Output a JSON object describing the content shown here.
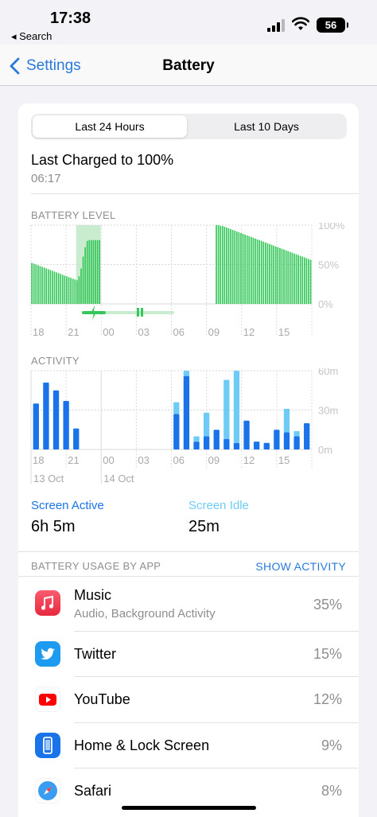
{
  "status_bar": {
    "time": "17:38",
    "back_app": "◂ Search",
    "battery_level": "56"
  },
  "nav": {
    "back_label": "Settings",
    "title": "Battery"
  },
  "segment": {
    "option_1": "Last 24 Hours",
    "option_2": "Last 10 Days",
    "selected": "Last 24 Hours"
  },
  "last_charged": {
    "title": "Last Charged to 100%",
    "time": "06:17"
  },
  "battery_level_label": "BATTERY LEVEL",
  "activity_label": "ACTIVITY",
  "colors": {
    "battery_green": "#34c759",
    "charge_bg": "#c8eccd",
    "active_blue": "#1a73e8",
    "idle_blue": "#6ecbf5",
    "link_blue": "#2a7ad8"
  },
  "chart_data": [
    {
      "type": "bar",
      "name": "battery-level",
      "y_ticks": [
        "100%",
        "50%",
        "0%"
      ],
      "x_ticks": [
        "18",
        "21",
        "00",
        "03",
        "06",
        "09",
        "12",
        "15"
      ],
      "ylim": [
        0,
        100
      ],
      "charging_window_bars": [
        22,
        34
      ],
      "values": [
        52,
        51,
        50,
        49,
        48,
        47,
        46,
        45,
        44,
        43,
        42,
        41,
        40,
        39,
        38,
        37,
        36,
        35,
        34,
        33,
        32,
        31,
        30,
        35,
        45,
        60,
        72,
        80,
        81,
        81,
        81,
        81,
        81,
        81,
        0,
        0,
        0,
        0,
        0,
        0,
        0,
        0,
        0,
        0,
        0,
        0,
        0,
        0,
        0,
        0,
        0,
        0,
        0,
        0,
        0,
        0,
        0,
        0,
        0,
        0,
        0,
        0,
        0,
        0,
        0,
        0,
        0,
        0,
        0,
        0,
        0,
        0,
        0,
        0,
        0,
        0,
        0,
        0,
        0,
        0,
        0,
        0,
        0,
        0,
        0,
        0,
        0,
        0,
        0,
        0,
        100,
        100,
        99,
        99,
        98,
        97,
        96,
        95,
        94,
        93,
        92,
        91,
        90,
        89,
        88,
        87,
        86,
        85,
        84,
        83,
        82,
        81,
        80,
        79,
        78,
        77,
        76,
        75,
        74,
        73,
        72,
        71,
        70,
        69,
        68,
        67,
        66,
        65,
        64,
        63,
        62,
        61,
        60,
        59,
        58,
        57,
        56
      ]
    },
    {
      "type": "bar",
      "name": "activity",
      "y_ticks": [
        "60m",
        "30m",
        "0m"
      ],
      "x_ticks": [
        "18",
        "21",
        "00",
        "03",
        "06",
        "09",
        "12",
        "15"
      ],
      "date_labels": [
        "13 Oct",
        "14 Oct"
      ],
      "ylim": [
        0,
        60
      ],
      "series": [
        {
          "name": "Screen Active",
          "values": [
            35,
            51,
            45,
            37,
            16,
            0,
            0,
            0,
            0,
            0,
            0,
            0,
            0,
            0,
            27,
            56,
            6,
            10,
            15,
            8,
            5,
            22,
            6,
            5,
            15,
            13,
            10,
            20
          ]
        },
        {
          "name": "Screen Idle",
          "values": [
            0,
            0,
            0,
            0,
            0,
            0,
            0,
            0,
            0,
            0,
            0,
            0,
            0,
            0,
            9,
            4,
            4,
            18,
            0,
            45,
            55,
            0,
            0,
            0,
            0,
            18,
            4,
            0
          ]
        }
      ]
    }
  ],
  "legend": {
    "active": {
      "label": "Screen Active",
      "value": "6h 5m"
    },
    "idle": {
      "label": "Screen Idle",
      "value": "25m"
    }
  },
  "usage": {
    "header": "BATTERY USAGE BY APP",
    "show_activity": "SHOW ACTIVITY",
    "apps": [
      {
        "name": "Music",
        "subtitle": "Audio, Background Activity",
        "percent": "35%",
        "icon": "music-icon"
      },
      {
        "name": "Twitter",
        "subtitle": "",
        "percent": "15%",
        "icon": "twitter-icon"
      },
      {
        "name": "YouTube",
        "subtitle": "",
        "percent": "12%",
        "icon": "youtube-icon"
      },
      {
        "name": "Home & Lock Screen",
        "subtitle": "",
        "percent": "9%",
        "icon": "phone-icon"
      },
      {
        "name": "Safari",
        "subtitle": "",
        "percent": "8%",
        "icon": "safari-icon"
      }
    ]
  }
}
